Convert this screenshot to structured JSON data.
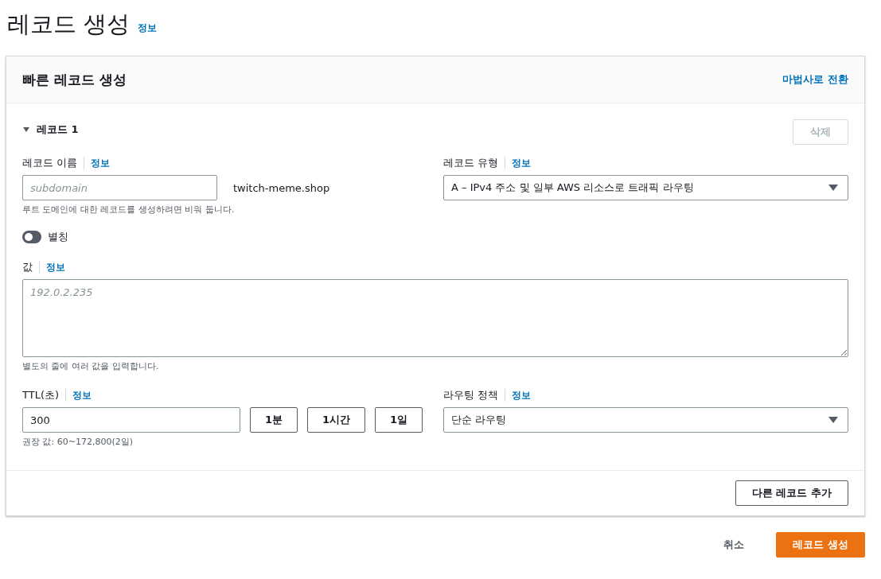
{
  "page": {
    "title": "레코드 생성",
    "info_link": "정보"
  },
  "card": {
    "title": "빠른 레코드 생성",
    "switch_link": "마법사로 전환"
  },
  "record": {
    "title": "레코드 1",
    "expanded": true,
    "delete_button": {
      "label": "삭제",
      "disabled": true
    },
    "name": {
      "label": "레코드 이름",
      "info_link": "정보",
      "placeholder": "subdomain",
      "suffix": "twitch-meme.shop",
      "hint": "루트 도메인에 대한 레코드를 생성하려면 비워 둡니다."
    },
    "type": {
      "label": "레코드 유형",
      "info_link": "정보",
      "value": "A – IPv4 주소 및 일부 AWS 리소스로 트래픽 라우팅"
    },
    "alias": {
      "label": "별칭",
      "on": false
    },
    "value": {
      "label": "값",
      "info_link": "정보",
      "placeholder": "192.0.2.235",
      "hint": "별도의 줄에 여러 값을 입력합니다."
    },
    "ttl": {
      "label": "TTL(초)",
      "info_link": "정보",
      "value": "300",
      "presets": [
        "1분",
        "1시간",
        "1일"
      ],
      "hint": "권장 값: 60~172,800(2일)"
    },
    "routing": {
      "label": "라우팅 정책",
      "info_link": "정보",
      "value": "단순 라우팅"
    }
  },
  "add_button": "다른 레코드 추가",
  "footer": {
    "cancel": "취소",
    "submit": "레코드 생성"
  }
}
